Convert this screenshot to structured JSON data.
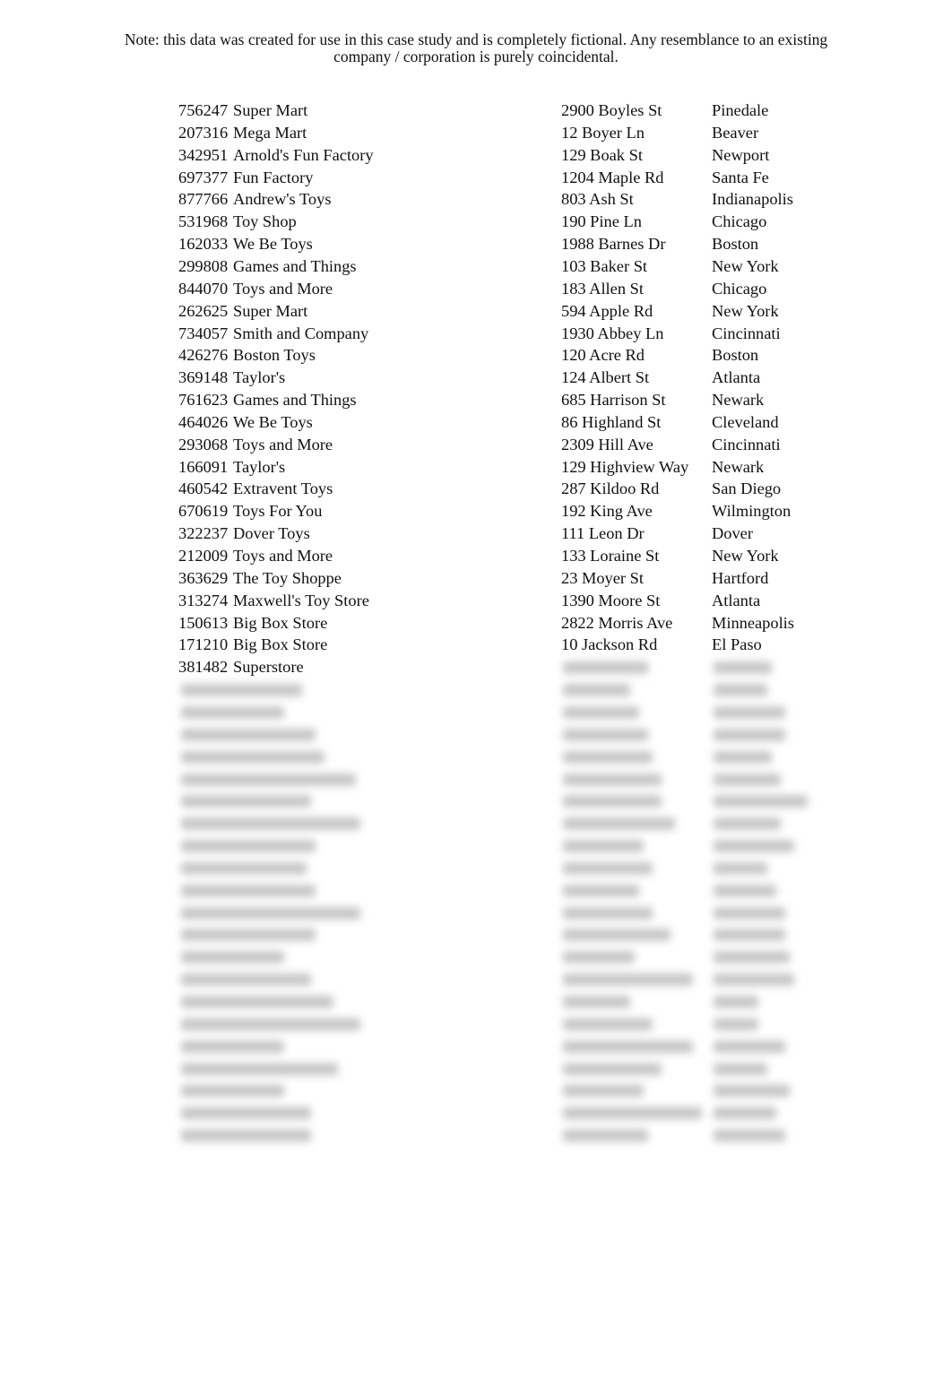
{
  "note": {
    "line1": "Note: this data was created for use in this case study and is completely fictional.    Any resemblance to an existing",
    "line2": "company / corporation is purely coincidental."
  },
  "records": [
    {
      "id": "756247",
      "name": "Super Mart",
      "address": "2900 Boyles St",
      "city": "Pinedale"
    },
    {
      "id": "207316",
      "name": "Mega Mart",
      "address": "12 Boyer Ln",
      "city": "Beaver"
    },
    {
      "id": "342951",
      "name": "Arnold's Fun Factory",
      "address": "129 Boak St",
      "city": "Newport"
    },
    {
      "id": "697377",
      "name": "Fun Factory",
      "address": "1204 Maple Rd",
      "city": "Santa Fe"
    },
    {
      "id": "877766",
      "name": "Andrew's Toys",
      "address": "803 Ash St",
      "city": "Indianapolis"
    },
    {
      "id": "531968",
      "name": "Toy Shop",
      "address": "190 Pine Ln",
      "city": "Chicago"
    },
    {
      "id": "162033",
      "name": "We Be Toys",
      "address": "1988 Barnes Dr",
      "city": "Boston"
    },
    {
      "id": "299808",
      "name": "Games and Things",
      "address": "103 Baker St",
      "city": "New York"
    },
    {
      "id": "844070",
      "name": "Toys and More",
      "address": "183 Allen St",
      "city": "Chicago"
    },
    {
      "id": "262625",
      "name": "Super Mart",
      "address": "594 Apple Rd",
      "city": "New York"
    },
    {
      "id": "734057",
      "name": "Smith and Company",
      "address": "1930 Abbey Ln",
      "city": "Cincinnati"
    },
    {
      "id": "426276",
      "name": "Boston Toys",
      "address": "120 Acre Rd",
      "city": "Boston"
    },
    {
      "id": "369148",
      "name": "Taylor's",
      "address": "124 Albert St",
      "city": "Atlanta"
    },
    {
      "id": "761623",
      "name": "Games and Things",
      "address": "685 Harrison St",
      "city": "Newark"
    },
    {
      "id": "464026",
      "name": "We Be Toys",
      "address": "86 Highland St",
      "city": "Cleveland"
    },
    {
      "id": "293068",
      "name": "Toys and More",
      "address": "2309 Hill Ave",
      "city": "Cincinnati"
    },
    {
      "id": "166091",
      "name": "Taylor's",
      "address": "129 Highview Way",
      "city": "Newark"
    },
    {
      "id": "460542",
      "name": "Extravent Toys",
      "address": "287 Kildoo Rd",
      "city": "San Diego"
    },
    {
      "id": "670619",
      "name": "Toys For You",
      "address": "192 King Ave",
      "city": "Wilmington"
    },
    {
      "id": "322237",
      "name": "Dover Toys",
      "address": "111 Leon Dr",
      "city": "Dover"
    },
    {
      "id": "212009",
      "name": "Toys and More",
      "address": "133 Loraine St",
      "city": "New York"
    },
    {
      "id": "363629",
      "name": "The Toy Shoppe",
      "address": "23 Moyer St",
      "city": "Hartford"
    },
    {
      "id": "313274",
      "name": "Maxwell's Toy Store",
      "address": "1390 Moore St",
      "city": "Atlanta"
    },
    {
      "id": "150613",
      "name": "Big Box Store",
      "address": "2822 Morris Ave",
      "city": "Minneapolis"
    },
    {
      "id": "171210",
      "name": "Big Box Store",
      "address": "10 Jackson Rd",
      "city": "El Paso"
    },
    {
      "id": "381482",
      "name": "Superstore",
      "address": null,
      "city": null
    }
  ],
  "blurred_rows_count": 22
}
